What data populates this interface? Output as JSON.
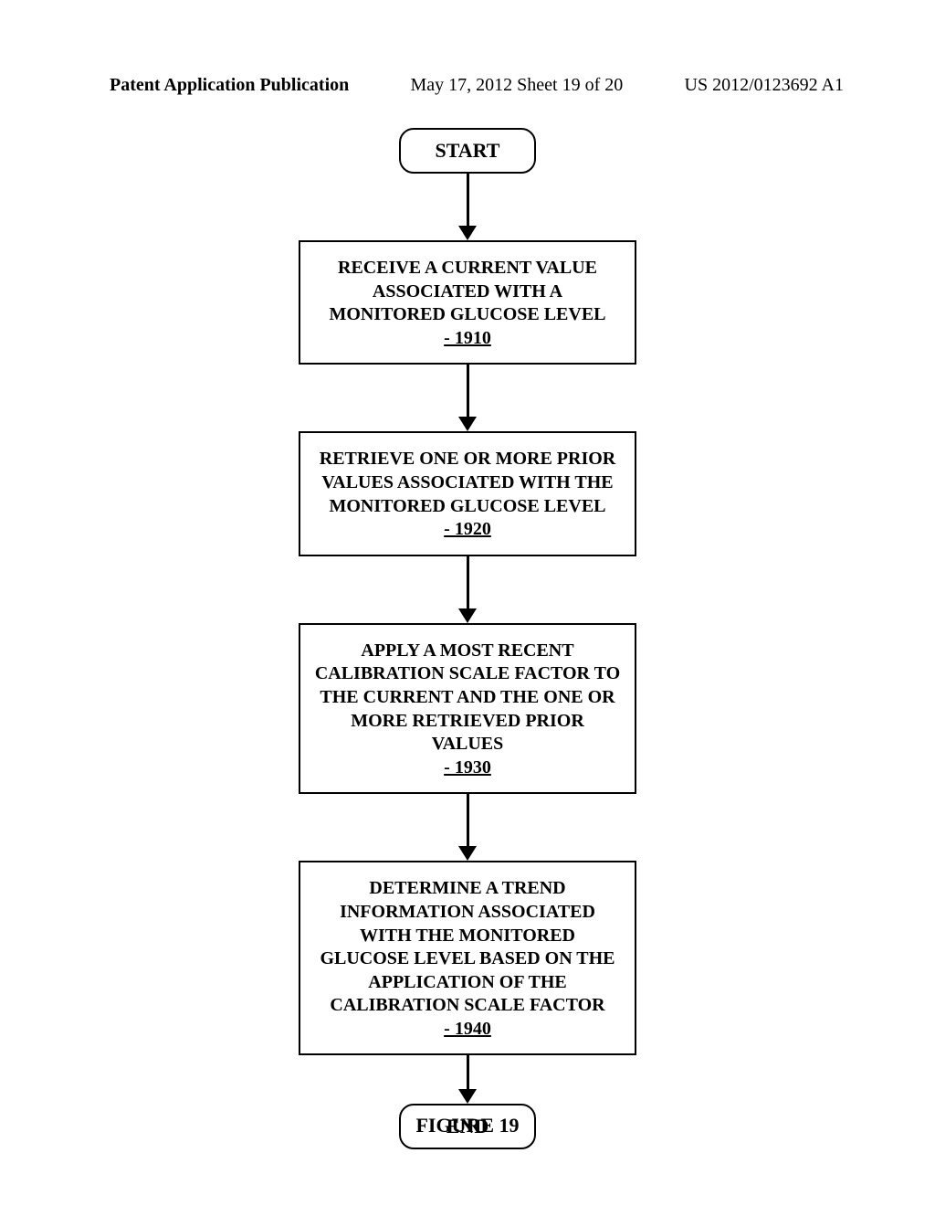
{
  "header": {
    "left": "Patent Application Publication",
    "mid": "May 17, 2012  Sheet 19 of 20",
    "right": "US 2012/0123692 A1"
  },
  "flow": {
    "start": "START",
    "step1": {
      "text": "RECEIVE A CURRENT VALUE ASSOCIATED WITH A MONITORED GLUCOSE LEVEL",
      "ref": "- 1910"
    },
    "step2": {
      "text": "RETRIEVE ONE OR MORE PRIOR VALUES ASSOCIATED WITH THE MONITORED GLUCOSE LEVEL",
      "ref": "- 1920"
    },
    "step3": {
      "text": "APPLY A MOST RECENT CALIBRATION SCALE FACTOR TO THE CURRENT AND THE ONE OR MORE RETRIEVED PRIOR VALUES",
      "ref": "- 1930"
    },
    "step4": {
      "text": "DETERMINE A TREND INFORMATION ASSOCIATED WITH THE MONITORED GLUCOSE LEVEL BASED ON THE APPLICATION OF THE CALIBRATION SCALE FACTOR",
      "ref": "- 1940"
    },
    "end": "END"
  },
  "figure_label": "FIGURE 19"
}
